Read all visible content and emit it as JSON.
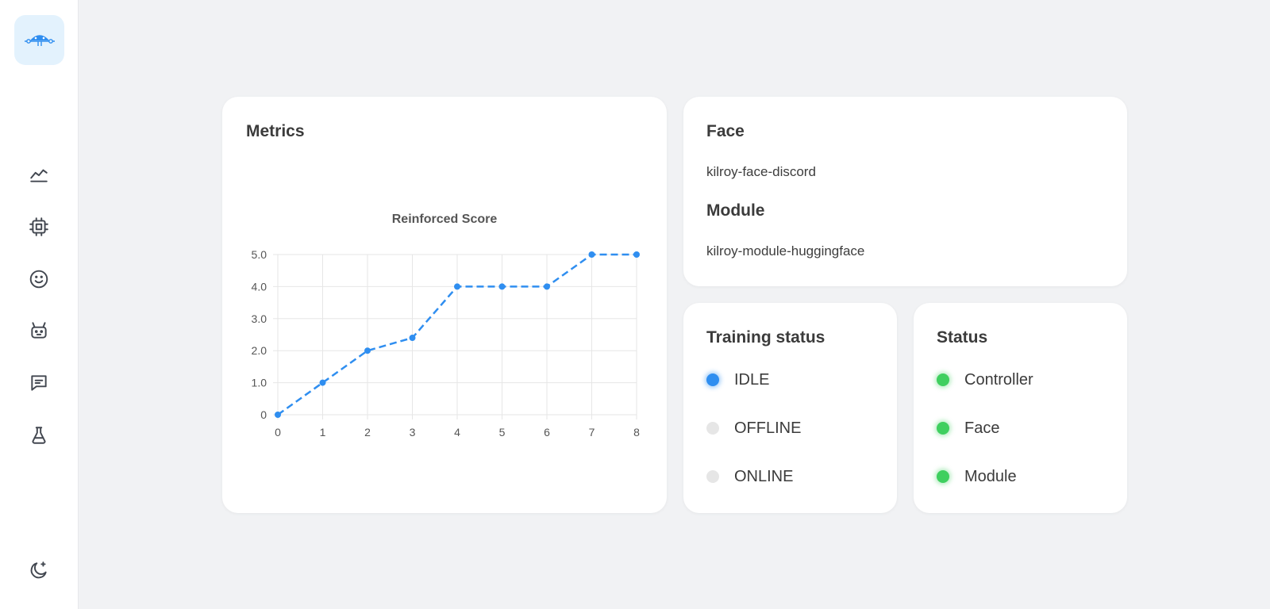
{
  "sidebar": {
    "logo_icon": "kilroy-logo-icon",
    "items": [
      {
        "icon": "chart-line-icon"
      },
      {
        "icon": "cpu-chip-icon"
      },
      {
        "icon": "face-smile-icon"
      },
      {
        "icon": "robot-icon"
      },
      {
        "icon": "chat-bubble-icon"
      },
      {
        "icon": "flask-icon"
      }
    ],
    "theme_icon": "moon-stars-icon"
  },
  "metrics": {
    "title": "Metrics"
  },
  "chart_data": {
    "type": "line",
    "title": "Reinforced Score",
    "x": [
      0,
      1,
      2,
      3,
      4,
      5,
      6,
      7,
      8
    ],
    "y": [
      0,
      1.0,
      2.0,
      2.4,
      4.0,
      4.0,
      4.0,
      5.0,
      5.0
    ],
    "ylim": [
      0,
      5
    ],
    "yticks": [
      "0",
      "1.0",
      "2.0",
      "3.0",
      "4.0",
      "5.0"
    ],
    "xticks": [
      "0",
      "1",
      "2",
      "3",
      "4",
      "5",
      "6",
      "7",
      "8"
    ],
    "line_style": "dashed",
    "color": "#2f8ef0",
    "grid": true
  },
  "info": {
    "face_title": "Face",
    "face_value": "kilroy-face-discord",
    "module_title": "Module",
    "module_value": "kilroy-module-huggingface"
  },
  "training": {
    "title": "Training status",
    "states": [
      {
        "label": "IDLE",
        "active": true,
        "color": "#2f8ef0"
      },
      {
        "label": "OFFLINE",
        "active": false
      },
      {
        "label": "ONLINE",
        "active": false
      }
    ]
  },
  "status": {
    "title": "Status",
    "items": [
      {
        "label": "Controller",
        "color": "#3fcf5f"
      },
      {
        "label": "Face",
        "color": "#3fcf5f"
      },
      {
        "label": "Module",
        "color": "#3fcf5f"
      }
    ]
  }
}
